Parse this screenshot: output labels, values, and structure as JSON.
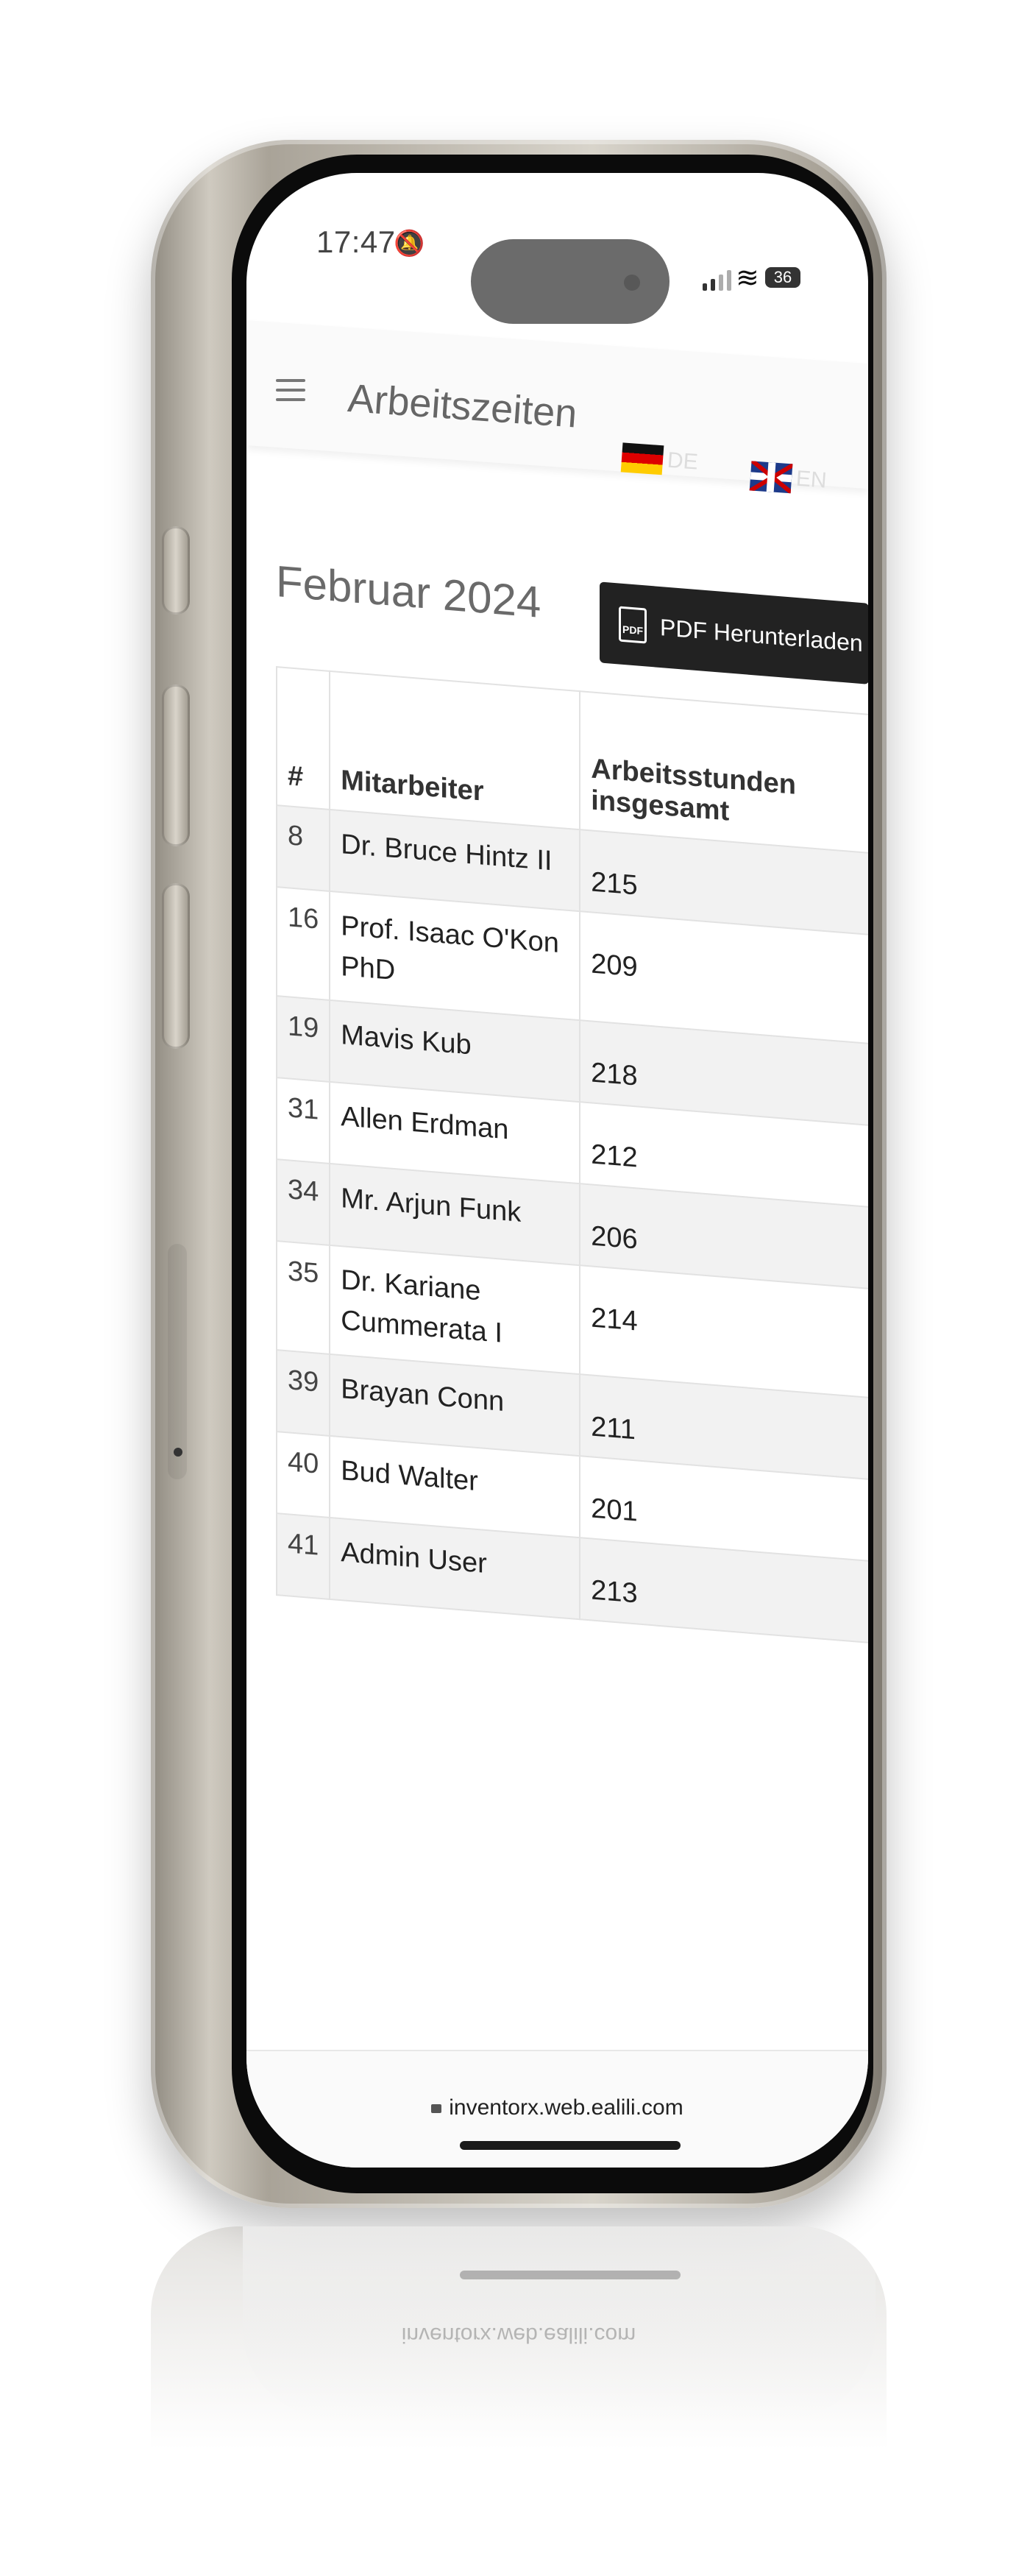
{
  "status_bar": {
    "time": "17:47",
    "battery": "36"
  },
  "app": {
    "title": "Arbeitszeiten"
  },
  "languages": [
    {
      "code": "DE"
    },
    {
      "code": "EN"
    }
  ],
  "report": {
    "month": "Februar 2024",
    "pdf_button": "PDF Herunterladen",
    "pdf_icon_label": "PDF"
  },
  "table": {
    "headers": [
      "#",
      "Mitarbeiter",
      "Arbeitsstunden insgesamt"
    ],
    "rows": [
      {
        "id": "8",
        "name": "Dr. Bruce Hintz II",
        "hours": "215"
      },
      {
        "id": "16",
        "name": "Prof. Isaac O'Kon PhD",
        "hours": "209"
      },
      {
        "id": "19",
        "name": "Mavis Kub",
        "hours": "218"
      },
      {
        "id": "31",
        "name": "Allen Erdman",
        "hours": "212"
      },
      {
        "id": "34",
        "name": "Mr. Arjun Funk",
        "hours": "206"
      },
      {
        "id": "35",
        "name": "Dr. Kariane Cummerata I",
        "hours": "214"
      },
      {
        "id": "39",
        "name": "Brayan Conn",
        "hours": "211"
      },
      {
        "id": "40",
        "name": "Bud Walter",
        "hours": "201"
      },
      {
        "id": "41",
        "name": "Admin User",
        "hours": "213"
      }
    ]
  },
  "browser": {
    "url": "inventorx.web.ealili.com"
  }
}
